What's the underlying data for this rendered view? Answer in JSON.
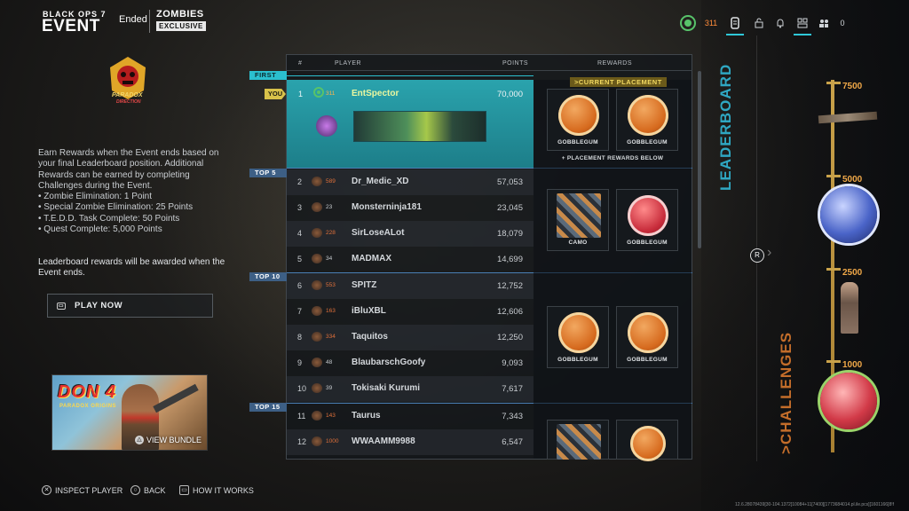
{
  "header": {
    "game": "BLACK OPS 7",
    "event": "EVENT",
    "status": "Ended",
    "mode": "ZOMBIES",
    "tag": "EXCLUSIVE"
  },
  "topbar": {
    "level": "311",
    "count": "0"
  },
  "left": {
    "emblem_text": "PARADOX",
    "emblem_sub": "DIRECTION",
    "description": "Earn Rewards when the Event ends based on your final Leaderboard position. Additional Rewards can be earned by completing Challenges during the Event.",
    "bullets": [
      "• Zombie Elimination: 1 Point",
      "• Special Zombie Elimination: 25 Points",
      "• T.E.D.D. Task Complete: 50 Points",
      "• Quest Complete: 5,000 Points"
    ],
    "note": "Leaderboard rewards will be awarded when the Event ends.",
    "play_now": "PLAY NOW",
    "bundle_title": "DON 4",
    "bundle_sub": "PARADOX ORIGINS",
    "view_bundle": "VIEW BUNDLE"
  },
  "leaderboard": {
    "col_rank": "#",
    "col_player": "PLAYER",
    "col_points": "POINTS",
    "col_rewards": "REWARDS",
    "tiers": {
      "first": "FIRST",
      "top5": "TOP 5",
      "top10": "TOP 10",
      "top15": "TOP 15"
    },
    "you": "YOU",
    "first": {
      "rank": "1",
      "level": "311",
      "name": "EntSpector",
      "points": "70,000"
    },
    "rows": [
      {
        "rank": "2",
        "level": "589",
        "name": "Dr_Medic_XD",
        "points": "57,053"
      },
      {
        "rank": "3",
        "level": "23",
        "name": "Monsterninja181",
        "points": "23,045"
      },
      {
        "rank": "4",
        "level": "228",
        "name": "SirLoseALot",
        "points": "18,079"
      },
      {
        "rank": "5",
        "level": "34",
        "name": "MADMAX",
        "points": "14,699"
      },
      {
        "rank": "6",
        "level": "553",
        "name": "SPITZ",
        "points": "12,752"
      },
      {
        "rank": "7",
        "level": "163",
        "name": "iBluXBL",
        "points": "12,606"
      },
      {
        "rank": "8",
        "level": "334",
        "name": "Taquitos",
        "points": "12,250"
      },
      {
        "rank": "9",
        "level": "48",
        "name": "BlaubarschGoofy",
        "points": "9,093"
      },
      {
        "rank": "10",
        "level": "39",
        "name": "Tokisaki Kurumi",
        "points": "7,617"
      },
      {
        "rank": "11",
        "level": "143",
        "name": "Taurus",
        "points": "7,343"
      },
      {
        "rank": "12",
        "level": "1000",
        "name": "WWAAMM9988",
        "points": "6,547"
      }
    ],
    "current_placement": ">CURRENT PLACEMENT",
    "placement_below": "+ PLACEMENT REWARDS BELOW",
    "rewards": {
      "r1a": "GOBBLEGUM",
      "r1b": "GOBBLEGUM",
      "r2a": "CAMO",
      "r2b": "GOBBLEGUM",
      "r3a": "GOBBLEGUM",
      "r3b": "GOBBLEGUM"
    }
  },
  "right": {
    "leaderboard_label": "LEADERBOARD",
    "challenges_label": ">CHALLENGES",
    "marker": "R",
    "milestones": [
      "7500",
      "5000",
      "2500",
      "1000"
    ]
  },
  "footer": {
    "inspect": "INSPECT PLAYER",
    "back": "BACK",
    "how": "HOW IT WORKS",
    "build": "12.6.28078439[30-104.1372]10084+11[7400][1773684014.pl.ile.pcs][1601166]8!f"
  }
}
